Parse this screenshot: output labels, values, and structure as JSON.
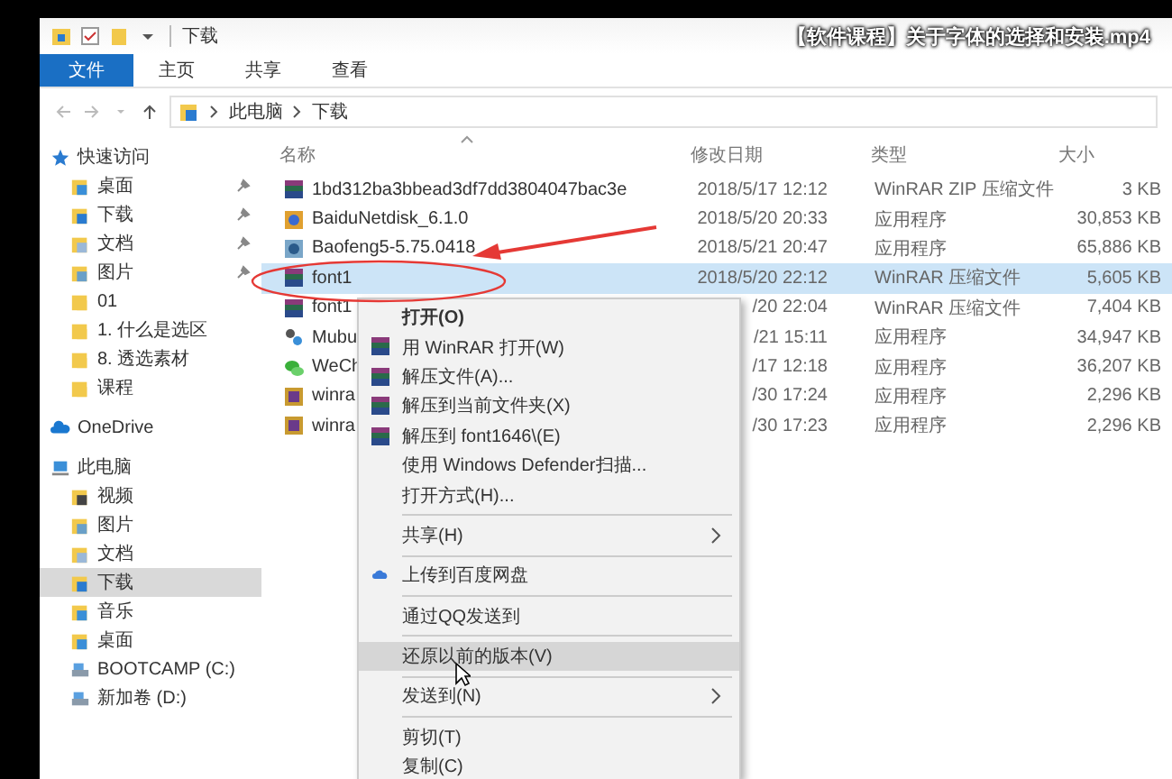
{
  "title_bar": {
    "folder": "下载",
    "video_title": "【软件课程】关于字体的选择和安装.mp4"
  },
  "ribbon": {
    "tabs": [
      {
        "label": "文件",
        "selected": true
      },
      {
        "label": "主页",
        "selected": false
      },
      {
        "label": "共享",
        "selected": false
      },
      {
        "label": "查看",
        "selected": false
      }
    ]
  },
  "address_bar": {
    "path": [
      "此电脑",
      "下载"
    ]
  },
  "nav": {
    "quick_access": {
      "label": "快速访问",
      "items": [
        {
          "label": "桌面",
          "kind": "desktop",
          "pinned": true,
          "selected": false
        },
        {
          "label": "下载",
          "kind": "download",
          "pinned": true,
          "selected": false
        },
        {
          "label": "文档",
          "kind": "document",
          "pinned": true,
          "selected": false
        },
        {
          "label": "图片",
          "kind": "picture",
          "pinned": true,
          "selected": false
        },
        {
          "label": "01",
          "kind": "folder",
          "pinned": false,
          "selected": false
        },
        {
          "label": "1. 什么是选区",
          "kind": "folder",
          "pinned": false,
          "selected": false
        },
        {
          "label": "8. 透选素材",
          "kind": "folder",
          "pinned": false,
          "selected": false
        },
        {
          "label": "课程",
          "kind": "folder",
          "pinned": false,
          "selected": false
        }
      ]
    },
    "onedrive": {
      "label": "OneDrive"
    },
    "this_pc": {
      "label": "此电脑",
      "items": [
        {
          "label": "视频",
          "kind": "video",
          "selected": false
        },
        {
          "label": "图片",
          "kind": "picture",
          "selected": false
        },
        {
          "label": "文档",
          "kind": "document",
          "selected": false
        },
        {
          "label": "下载",
          "kind": "download",
          "selected": true
        },
        {
          "label": "音乐",
          "kind": "music",
          "selected": false
        },
        {
          "label": "桌面",
          "kind": "desktop",
          "selected": false
        },
        {
          "label": "BOOTCAMP (C:)",
          "kind": "drive",
          "selected": false
        },
        {
          "label": "新加卷 (D:)",
          "kind": "drive",
          "selected": false
        }
      ]
    }
  },
  "table": {
    "columns": [
      "名称",
      "修改日期",
      "类型",
      "大小"
    ],
    "rows": [
      {
        "name": "1bd312ba3bbead3df7dd3804047bac3e",
        "kind": "archive",
        "date": "2018/5/17 12:12",
        "type": "WinRAR ZIP 压缩文件",
        "size": "3 KB",
        "selected": false
      },
      {
        "name": "BaiduNetdisk_6.1.0",
        "kind": "installer",
        "date": "2018/5/20 20:33",
        "type": "应用程序",
        "size": "30,853 KB",
        "selected": false
      },
      {
        "name": "Baofeng5-5.75.0418",
        "kind": "player",
        "date": "2018/5/21 20:47",
        "type": "应用程序",
        "size": "65,886 KB",
        "selected": false
      },
      {
        "name": "font1",
        "kind": "archive",
        "date": "2018/5/20 22:12",
        "type": "WinRAR 压缩文件",
        "size": "5,605 KB",
        "selected": true
      },
      {
        "name": "font1",
        "kind": "archive",
        "date": "/20 22:04",
        "type": "WinRAR 压缩文件",
        "size": "7,404 KB",
        "selected": false
      },
      {
        "name": "Mubu",
        "kind": "app",
        "date": "/21 15:11",
        "type": "应用程序",
        "size": "34,947 KB",
        "selected": false
      },
      {
        "name": "WeCh",
        "kind": "chat",
        "date": "/17 12:18",
        "type": "应用程序",
        "size": "36,207 KB",
        "selected": false
      },
      {
        "name": "winra",
        "kind": "setup",
        "date": "/30 17:24",
        "type": "应用程序",
        "size": "2,296 KB",
        "selected": false
      },
      {
        "name": "winra",
        "kind": "setup",
        "date": "/30 17:23",
        "type": "应用程序",
        "size": "2,296 KB",
        "selected": false
      }
    ]
  },
  "context_menu": [
    {
      "kind": "item",
      "label": "打开(O)",
      "default": true,
      "submenu": false,
      "selected": false
    },
    {
      "kind": "archive",
      "label": "用 WinRAR 打开(W)",
      "default": false,
      "submenu": false,
      "selected": false
    },
    {
      "kind": "archive",
      "label": "解压文件(A)...",
      "default": false,
      "submenu": false,
      "selected": false
    },
    {
      "kind": "archive",
      "label": "解压到当前文件夹(X)",
      "default": false,
      "submenu": false,
      "selected": false
    },
    {
      "kind": "archive",
      "label": "解压到 font1646\\(E)",
      "default": false,
      "submenu": false,
      "selected": false
    },
    {
      "kind": "item",
      "label": "使用 Windows Defender扫描...",
      "default": false,
      "submenu": false,
      "selected": false
    },
    {
      "kind": "item",
      "label": "打开方式(H)...",
      "default": false,
      "submenu": false,
      "selected": false
    },
    {
      "kind": "separator"
    },
    {
      "kind": "item",
      "label": "共享(H)",
      "default": false,
      "submenu": true,
      "selected": false
    },
    {
      "kind": "separator"
    },
    {
      "kind": "upload",
      "label": "上传到百度网盘",
      "default": false,
      "submenu": false,
      "selected": false
    },
    {
      "kind": "separator"
    },
    {
      "kind": "item",
      "label": "通过QQ发送到",
      "default": false,
      "submenu": false,
      "selected": false
    },
    {
      "kind": "separator"
    },
    {
      "kind": "item",
      "label": "还原以前的版本(V)",
      "default": false,
      "submenu": false,
      "selected": true
    },
    {
      "kind": "separator"
    },
    {
      "kind": "item",
      "label": "发送到(N)",
      "default": false,
      "submenu": true,
      "selected": false
    },
    {
      "kind": "separator"
    },
    {
      "kind": "item",
      "label": "剪切(T)",
      "default": false,
      "submenu": false,
      "selected": false
    },
    {
      "kind": "item",
      "label": "复制(C)",
      "default": false,
      "submenu": false,
      "selected": false
    }
  ]
}
